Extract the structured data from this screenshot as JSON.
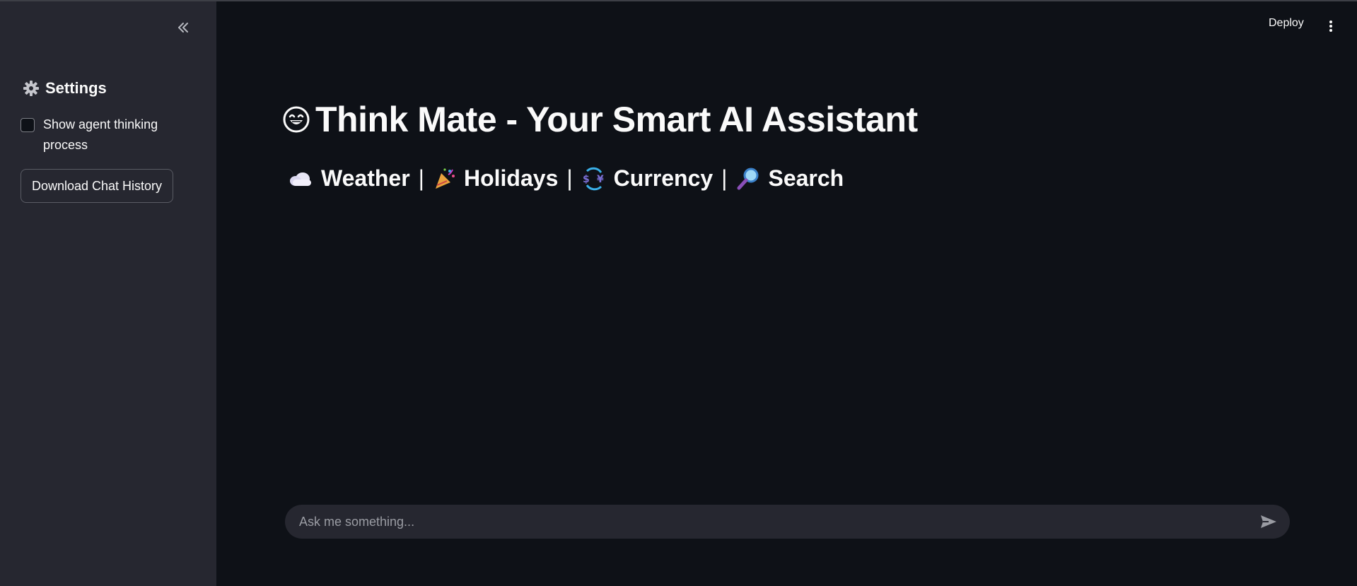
{
  "sidebar": {
    "settings_title": "Settings",
    "settings_icon": "gear-icon",
    "checkbox_label": "Show agent thinking process",
    "checkbox_checked": false,
    "download_button": "Download Chat History"
  },
  "header": {
    "deploy_label": "Deploy"
  },
  "main": {
    "title": "Think Mate - Your Smart AI Assistant",
    "title_icon": "smiling-face-icon",
    "features": [
      {
        "label": "Weather",
        "icon": "cloud-icon"
      },
      {
        "label": "Holidays",
        "icon": "party-popper-icon"
      },
      {
        "label": "Currency",
        "icon": "currency-exchange-icon"
      },
      {
        "label": "Search",
        "icon": "magnifier-icon"
      }
    ],
    "separator": "|"
  },
  "chat": {
    "placeholder": "Ask me something..."
  },
  "colors": {
    "background": "#0e1117",
    "sidebar": "#262730",
    "text": "#fafafa",
    "input_bg": "#262730"
  }
}
